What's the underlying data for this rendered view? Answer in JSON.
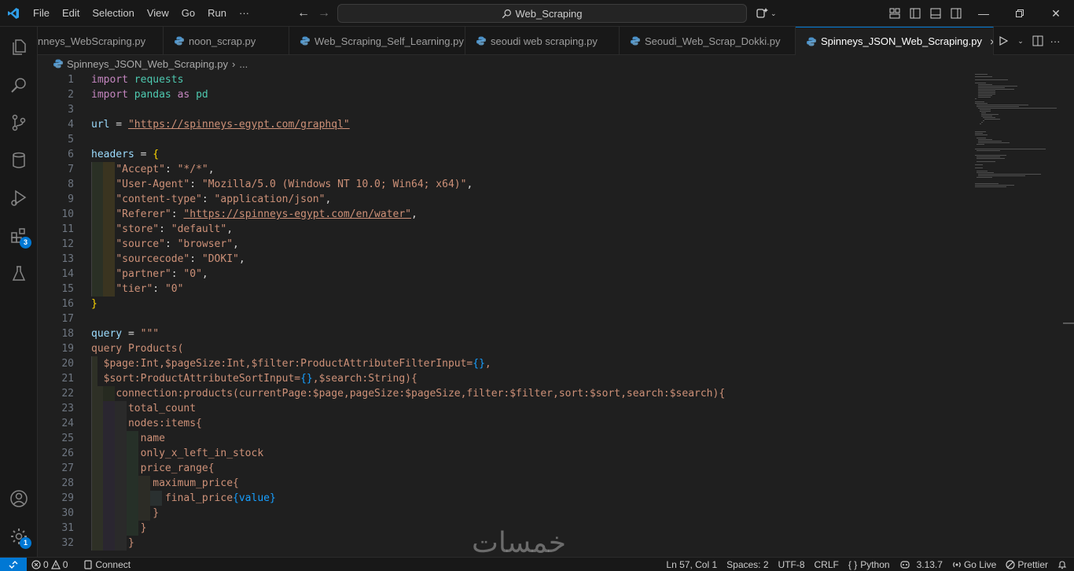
{
  "menus": [
    "File",
    "Edit",
    "Selection",
    "View",
    "Go",
    "Run",
    "···"
  ],
  "search_text": "Web_Scraping",
  "tabs": [
    {
      "label": "nneys_WebScraping.py",
      "active": false
    },
    {
      "label": "noon_scrap.py",
      "active": false
    },
    {
      "label": "Web_Scraping_Self_Learning.py",
      "active": false
    },
    {
      "label": "seoudi web scraping.py",
      "active": false
    },
    {
      "label": "Seoudi_Web_Scrap_Dokki.py",
      "active": false
    },
    {
      "label": "Spinneys_JSON_Web_Scraping.py",
      "active": true
    }
  ],
  "breadcrumb": {
    "file": "Spinneys_JSON_Web_Scraping.py",
    "more": "..."
  },
  "activity_badges": {
    "extensions": "3",
    "settings": "1"
  },
  "line_numbers": [
    "1",
    "2",
    "3",
    "4",
    "5",
    "6",
    "7",
    "8",
    "9",
    "10",
    "11",
    "12",
    "13",
    "14",
    "15",
    "16",
    "17",
    "18",
    "19",
    "20",
    "21",
    "22",
    "23",
    "24",
    "25",
    "26",
    "27",
    "28",
    "29",
    "30",
    "31",
    "32"
  ],
  "code": {
    "l1": {
      "kw": "import",
      "mod": " requests"
    },
    "l2": {
      "kw": "import",
      "mod": " pandas",
      "as": " as",
      "alias": " pd"
    },
    "l4": {
      "var": "url",
      "op": " = ",
      "url": "\"https://spinneys-egypt.com/graphql\""
    },
    "l6": {
      "var": "headers",
      "op": " = ",
      "brace": "{"
    },
    "l7": {
      "key": "\"Accept\"",
      "sep": ": ",
      "val": "\"*/*\"",
      "end": ","
    },
    "l8": {
      "key": "\"User-Agent\"",
      "sep": ": ",
      "val": "\"Mozilla/5.0 (Windows NT 10.0; Win64; x64)\"",
      "end": ","
    },
    "l9": {
      "key": "\"content-type\"",
      "sep": ": ",
      "val": "\"application/json\"",
      "end": ","
    },
    "l10": {
      "key": "\"Referer\"",
      "sep": ": ",
      "val_url": "\"https://spinneys-egypt.com/en/water\"",
      "end": ","
    },
    "l11": {
      "key": "\"store\"",
      "sep": ": ",
      "val": "\"default\"",
      "end": ","
    },
    "l12": {
      "key": "\"source\"",
      "sep": ": ",
      "val": "\"browser\"",
      "end": ","
    },
    "l13": {
      "key": "\"sourcecode\"",
      "sep": ": ",
      "val": "\"DOKI\"",
      "end": ","
    },
    "l14": {
      "key": "\"partner\"",
      "sep": ": ",
      "val": "\"0\"",
      "end": ","
    },
    "l15": {
      "key": "\"tier\"",
      "sep": ": ",
      "val": "\"0\"",
      "end": ""
    },
    "l16": {
      "brace": "}"
    },
    "l18": {
      "var": "query",
      "op": " = ",
      "str": "\"\"\""
    },
    "l19": "query Products(",
    "l20": {
      "a": "$page:Int,$pageSize:Int,$filter:ProductAttributeFilterInput=",
      "b": "{}",
      "c": ","
    },
    "l21": {
      "a": "$sort:ProductAttributeSortInput=",
      "b": "{}",
      "c": ",$search:String){"
    },
    "l22": "connection:products(currentPage:$page,pageSize:$pageSize,filter:$filter,sort:$sort,search:$search){",
    "l23": "total_count",
    "l24": "nodes:items{",
    "l25": "name",
    "l26": "only_x_left_in_stock",
    "l27": "price_range{",
    "l28": "maximum_price{",
    "l29": {
      "a": "final_price",
      "b": "{value}"
    },
    "l30": "}",
    "l31": "}",
    "l32": "}"
  },
  "watermark": "خمسات",
  "status": {
    "errors": "0",
    "warnings": "0",
    "connect": "Connect",
    "position": "Ln 57, Col 1",
    "spaces": "Spaces: 2",
    "encoding": "UTF-8",
    "eol": "CRLF",
    "language": "Python",
    "python_version": "3.13.7",
    "go_live": "Go Live",
    "prettier": "Prettier",
    "language_braces": "{ }"
  },
  "colors": {
    "accent": "#0078d4",
    "editor_bg": "#1f1f1f",
    "chrome_bg": "#181818",
    "keyword": "#c586c0",
    "module": "#4ec9b0",
    "variable": "#9cdcfe",
    "string": "#ce9178",
    "brace": "#ffd700"
  }
}
